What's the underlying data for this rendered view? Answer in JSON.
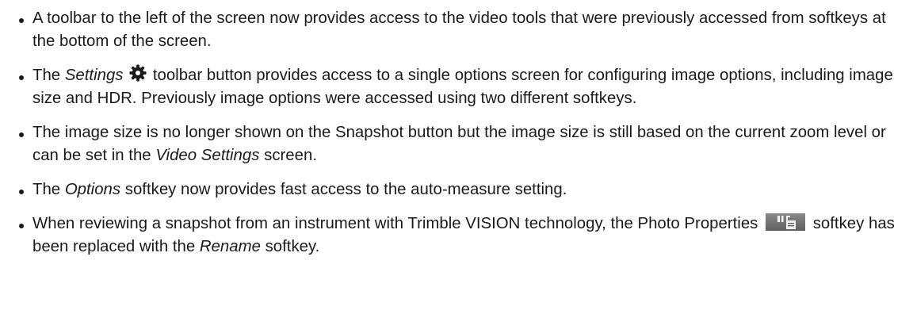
{
  "bullets": [
    {
      "text": "A toolbar to the left of the screen now provides access to the video tools that were previously accessed from softkeys at the bottom of the screen."
    },
    {
      "pre": "The ",
      "em1": "Settings",
      "post": " toolbar button provides access to a single options screen for configuring image options, including image size and HDR. Previously image options were accessed using two different softkeys.",
      "icon": "gear-icon"
    },
    {
      "pre": "The image size is no longer shown on the Snapshot button but the image size is still based on the current zoom level or can be set in the ",
      "em1": "Video Settings",
      "post": " screen."
    },
    {
      "pre": "The ",
      "em1": "Options",
      "post": " softkey now provides fast access to the auto-measure setting."
    },
    {
      "pre": "When reviewing a snapshot from an instrument with Trimble VISION technology, the Photo Properties ",
      "mid": " softkey has been replaced with the ",
      "em1": "Rename",
      "post": " softkey.",
      "icon": "photo-properties-icon"
    }
  ]
}
